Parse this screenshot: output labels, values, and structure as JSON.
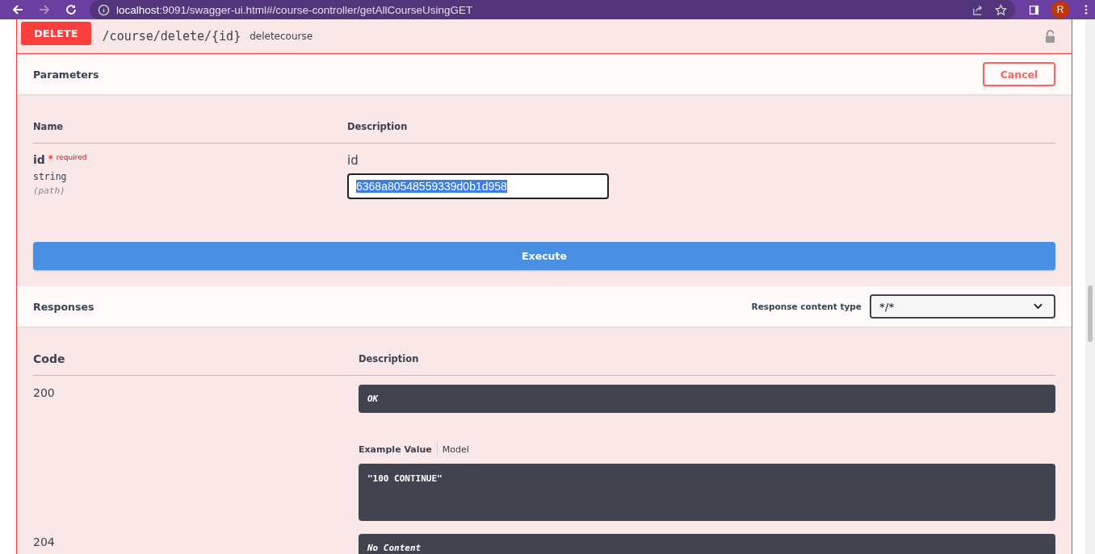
{
  "browser": {
    "url_host": "localhost",
    "url_rest": ":9091/swagger-ui.html#/course-controller/getAllCourseUsingGET",
    "avatar": "R"
  },
  "operation": {
    "method": "DELETE",
    "path": "/course/delete/{id}",
    "summary": "deletecourse"
  },
  "parameters": {
    "title": "Parameters",
    "cancel": "Cancel",
    "columns": [
      "Name",
      "Description"
    ],
    "rows": [
      {
        "name": "id",
        "star": "*",
        "required": "required",
        "type": "string",
        "location": "(path)",
        "description": "id",
        "value": "6368a80548559339d0b1d958",
        "text_selected": true
      }
    ]
  },
  "execute": "Execute",
  "responses": {
    "title": "Responses",
    "content_type_label": "Response content type",
    "content_type": "*/*",
    "columns": [
      "Code",
      "Description"
    ],
    "rows": [
      {
        "code": "200",
        "description": "OK",
        "tabs": [
          {
            "label": "Example Value",
            "selected": true
          },
          {
            "label": "Model",
            "selected": false
          }
        ],
        "example": "\"100 CONTINUE\""
      },
      {
        "code": "204",
        "description": "No Content"
      }
    ]
  }
}
